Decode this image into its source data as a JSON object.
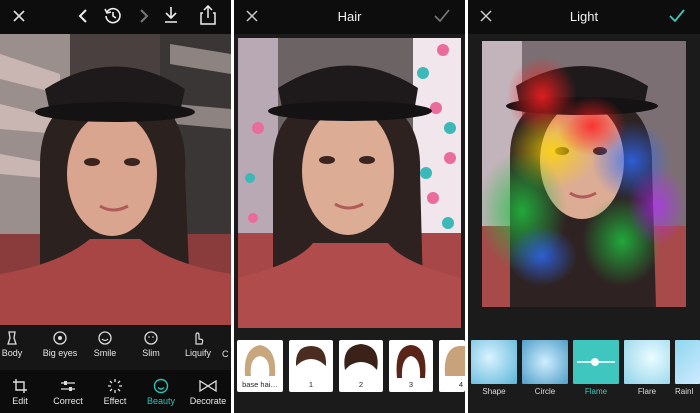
{
  "panel1": {
    "top_icons": [
      "close-icon",
      "back-icon",
      "history-icon",
      "forward-icon",
      "download-icon",
      "share-icon"
    ],
    "beauty_tools": [
      {
        "label": "Body",
        "icon": "body-icon"
      },
      {
        "label": "Big eyes",
        "icon": "big-eyes-icon"
      },
      {
        "label": "Smile",
        "icon": "smile-icon"
      },
      {
        "label": "Slim",
        "icon": "slim-icon"
      },
      {
        "label": "Liquify",
        "icon": "liquify-icon"
      },
      {
        "label": "C",
        "icon": ""
      }
    ],
    "nav": [
      {
        "label": "Edit",
        "icon": "crop-icon"
      },
      {
        "label": "Correct",
        "icon": "sliders-icon"
      },
      {
        "label": "Effect",
        "icon": "sparkle-icon"
      },
      {
        "label": "Beauty",
        "icon": "beauty-face-icon",
        "active": true
      },
      {
        "label": "Decorate",
        "icon": "bowtie-icon"
      }
    ],
    "active_color": "#29c4b4"
  },
  "panel2": {
    "title": "Hair",
    "hair_items": [
      {
        "label": "base hai…"
      },
      {
        "label": "1"
      },
      {
        "label": "2"
      },
      {
        "label": "3"
      },
      {
        "label": "4"
      }
    ]
  },
  "panel3": {
    "title": "Light",
    "light_items": [
      {
        "label": "Shape"
      },
      {
        "label": "Circle"
      },
      {
        "label": "Flame",
        "active": true
      },
      {
        "label": "Flare"
      },
      {
        "label": "Rainl"
      }
    ],
    "accent": "#3cc9b7"
  }
}
